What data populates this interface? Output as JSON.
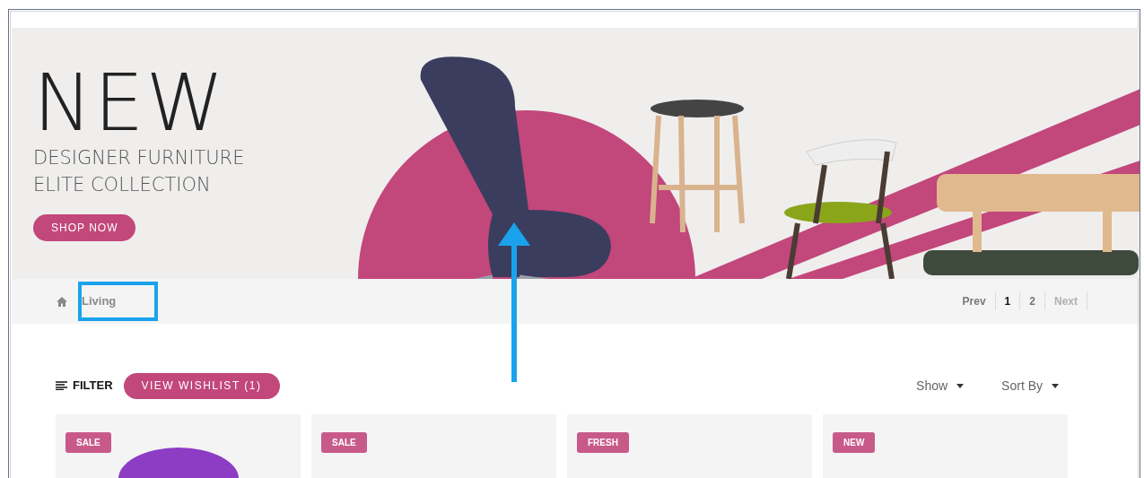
{
  "banner": {
    "headline": "NEW",
    "subtitle_lines": [
      "DESIGNER FURNITURE",
      "ELITE COLLECTION"
    ],
    "button": "SHOP NOW"
  },
  "breadcrumb": {
    "current": "Living"
  },
  "pagination": [
    {
      "label": "Prev",
      "selected": false,
      "disabled": false
    },
    {
      "label": "1",
      "selected": true,
      "disabled": false
    },
    {
      "label": "2",
      "selected": false,
      "disabled": false
    },
    {
      "label": "Next",
      "selected": false,
      "disabled": true
    }
  ],
  "toolbar": {
    "filter": "FILTER",
    "wishlist_button": "VIEW WISHLIST (1)",
    "dropdowns": [
      "Show",
      "Sort By"
    ]
  },
  "products": [
    {
      "badge": "SALE",
      "image": true
    },
    {
      "badge": "SALE",
      "image": false
    },
    {
      "badge": "FRESH",
      "image": false
    },
    {
      "badge": "NEW",
      "image": false
    }
  ]
}
